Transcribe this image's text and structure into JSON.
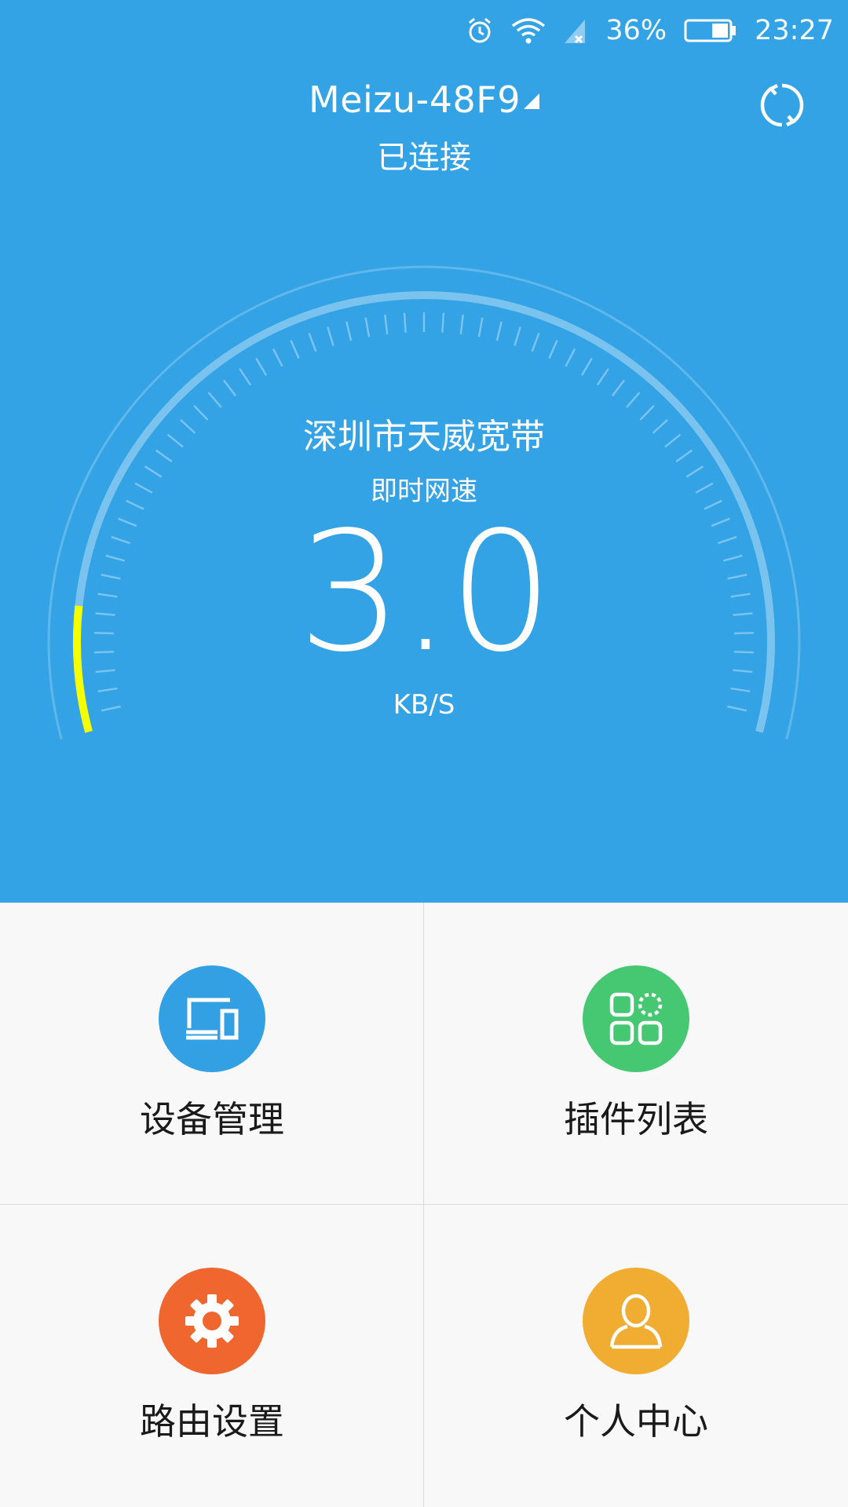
{
  "status_bar": {
    "battery_percent": "36%",
    "time": "23:27",
    "icons": [
      "alarm-icon",
      "wifi-icon",
      "cell-signal-icon",
      "battery-icon"
    ]
  },
  "header": {
    "ssid": "Meizu-48F9",
    "connection_status": "已连接"
  },
  "speed": {
    "isp": "深圳市天威宽带",
    "label": "即时网速",
    "value": "3.0",
    "unit": "KB/S",
    "gauge_level": 0.1
  },
  "menu": [
    {
      "label": "设备管理",
      "icon": "devices-icon",
      "color": "#33a0e3"
    },
    {
      "label": "插件列表",
      "icon": "plugins-icon",
      "color": "#46c872"
    },
    {
      "label": "路由设置",
      "icon": "gear-icon",
      "color": "#f0662f"
    },
    {
      "label": "个人中心",
      "icon": "user-icon",
      "color": "#f0ad31"
    }
  ],
  "colors": {
    "header_bg": "#34a3e5",
    "gauge_active": "#f5ff00"
  }
}
